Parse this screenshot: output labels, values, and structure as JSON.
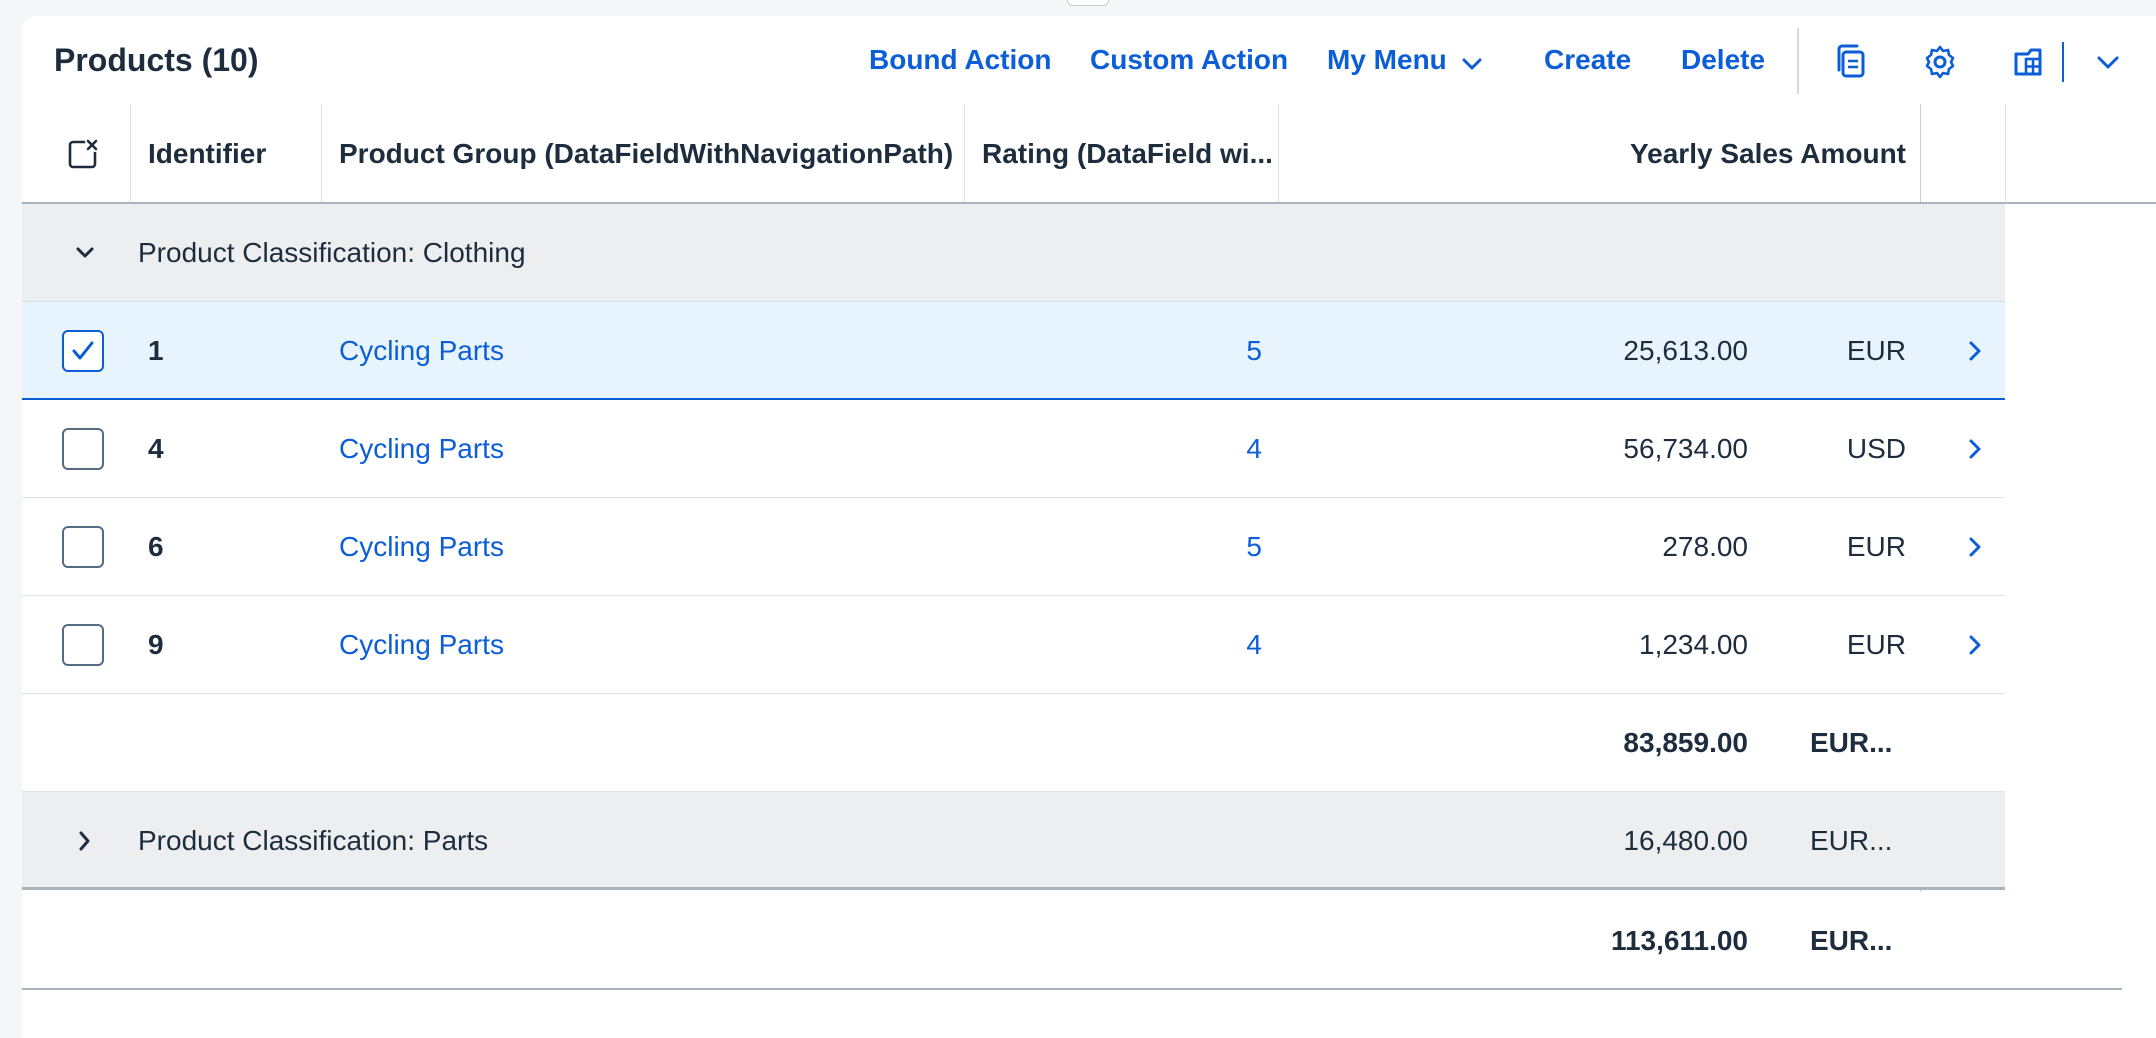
{
  "toolbar": {
    "title": "Products (10)",
    "bound_action": "Bound Action",
    "custom_action": "Custom Action",
    "my_menu": "My Menu",
    "create": "Create",
    "delete": "Delete"
  },
  "table": {
    "columns": {
      "identifier": "Identifier",
      "product_group": "Product Group (DataFieldWithNavigationPath)",
      "rating": "Rating (DataField wi...",
      "yearly_sales": "Yearly Sales Amount"
    },
    "groups": [
      {
        "label": "Product Classification: Clothing",
        "expanded": true,
        "rows": [
          {
            "id": "1",
            "group": "Cycling Parts",
            "rating": "5",
            "amount": "25,613.00",
            "currency": "EUR",
            "selected": true
          },
          {
            "id": "4",
            "group": "Cycling Parts",
            "rating": "4",
            "amount": "56,734.00",
            "currency": "USD",
            "selected": false
          },
          {
            "id": "6",
            "group": "Cycling Parts",
            "rating": "5",
            "amount": "278.00",
            "currency": "EUR",
            "selected": false
          },
          {
            "id": "9",
            "group": "Cycling Parts",
            "rating": "4",
            "amount": "1,234.00",
            "currency": "EUR",
            "selected": false
          }
        ],
        "subtotal_amount": "83,859.00",
        "subtotal_currency": "EUR..."
      },
      {
        "label": "Product Classification: Parts",
        "expanded": false,
        "subtotal_amount": "16,480.00",
        "subtotal_currency": "EUR..."
      }
    ],
    "total_amount": "113,611.00",
    "total_currency": "EUR..."
  },
  "icons": {
    "clear_selection": "clear-selection-icon",
    "copy": "copy-icon",
    "settings": "gear-icon",
    "export": "export-icon",
    "more": "chevron-down-icon",
    "row_nav": "chevron-right-icon"
  },
  "colors": {
    "link": "#0b5ed7",
    "selected_row": "#e8f4fd",
    "group_row": "#eceef0"
  }
}
